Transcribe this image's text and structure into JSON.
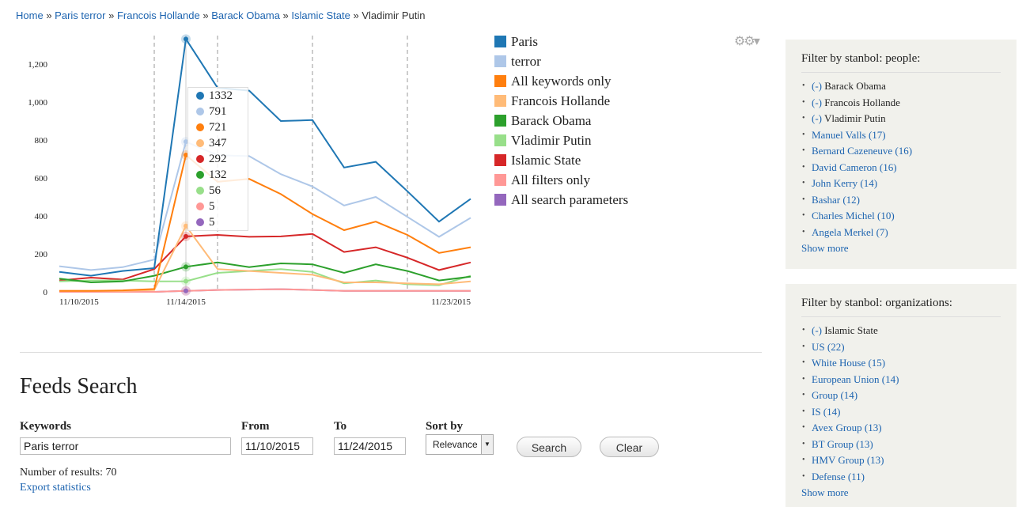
{
  "breadcrumb": {
    "links": [
      "Home",
      "Paris terror",
      "Francois Hollande",
      "Barack Obama",
      "Islamic State"
    ],
    "current": "Vladimir Putin",
    "separator": "»"
  },
  "chart_data": {
    "type": "line",
    "x": [
      "11/10/2015",
      "11/11/2015",
      "11/12/2015",
      "11/13/2015",
      "11/14/2015",
      "11/15/2015",
      "11/16/2015",
      "11/17/2015",
      "11/18/2015",
      "11/19/2015",
      "11/20/2015",
      "11/21/2015",
      "11/22/2015",
      "11/23/2015"
    ],
    "x_tick_labels": [
      "11/10/2015",
      "11/14/2015",
      "11/23/2015"
    ],
    "y_ticks": [
      0,
      200,
      400,
      600,
      800,
      "1,000",
      "1,200"
    ],
    "ylim": [
      0,
      1350
    ],
    "event_markers": [
      "11/13/2015",
      "11/15/2015",
      "11/18/2015",
      "11/21/2015"
    ],
    "series": [
      {
        "name": "Paris",
        "color": "#1f77b4",
        "values": [
          105,
          85,
          110,
          125,
          1332,
          1075,
          1060,
          900,
          905,
          655,
          685,
          530,
          370,
          490
        ]
      },
      {
        "name": "terror",
        "color": "#aec7e8",
        "values": [
          135,
          115,
          130,
          170,
          791,
          720,
          715,
          620,
          555,
          455,
          500,
          395,
          290,
          390
        ]
      },
      {
        "name": "All keywords only",
        "color": "#ff7f0e",
        "values": [
          5,
          5,
          8,
          15,
          721,
          580,
          595,
          515,
          410,
          325,
          370,
          300,
          205,
          235
        ]
      },
      {
        "name": "Francois Hollande",
        "color": "#ffbb78",
        "values": [
          5,
          5,
          5,
          10,
          347,
          120,
          110,
          100,
          90,
          50,
          50,
          45,
          40,
          55
        ]
      },
      {
        "name": "Barack Obama",
        "color": "#2ca02c",
        "values": [
          70,
          50,
          55,
          85,
          132,
          155,
          130,
          150,
          145,
          100,
          145,
          110,
          60,
          80
        ]
      },
      {
        "name": "Vladimir Putin",
        "color": "#98df8a",
        "values": [
          55,
          60,
          60,
          55,
          56,
          100,
          110,
          120,
          105,
          45,
          60,
          40,
          35,
          85
        ]
      },
      {
        "name": "Islamic State",
        "color": "#d62728",
        "values": [
          60,
          75,
          65,
          120,
          292,
          300,
          290,
          292,
          305,
          210,
          235,
          180,
          115,
          155
        ]
      },
      {
        "name": "All filters only",
        "color": "#ff9896",
        "values": [
          0,
          0,
          0,
          0,
          5,
          10,
          12,
          14,
          10,
          5,
          5,
          5,
          5,
          5
        ]
      },
      {
        "name": "All search parameters",
        "color": "#9467bd",
        "values": [
          0,
          0,
          0,
          0,
          5,
          10,
          12,
          14,
          10,
          5,
          5,
          5,
          5,
          5
        ]
      }
    ],
    "tooltip_values": [
      "1332",
      "791",
      "721",
      "347",
      "292",
      "132",
      "56",
      "5",
      "5"
    ],
    "legend_position": "right"
  },
  "icons": {
    "settings": "gear-icon"
  },
  "search": {
    "title": "Feeds Search",
    "keywords_label": "Keywords",
    "keywords_value": "Paris terror",
    "from_label": "From",
    "from_value": "11/10/2015",
    "to_label": "To",
    "to_value": "11/24/2015",
    "sort_label": "Sort by",
    "sort_value": "Relevance",
    "search_button": "Search",
    "clear_button": "Clear",
    "results": "Number of results: 70",
    "export": "Export statistics"
  },
  "people_panel": {
    "title": "Filter by stanbol: people:",
    "active": [
      "(-) Barack Obama",
      "(-) Francois Hollande",
      "(-) Vladimir Putin"
    ],
    "items": [
      "Manuel Valls (17)",
      "Bernard Cazeneuve (16)",
      "David Cameron (16)",
      "John Kerry (14)",
      "Bashar (12)",
      "Charles Michel (10)",
      "Angela Merkel (7)"
    ],
    "more": "Show more"
  },
  "org_panel": {
    "title": "Filter by stanbol: organizations:",
    "active": [
      "(-) Islamic State"
    ],
    "items": [
      "US (22)",
      "White House (15)",
      "European Union (14)",
      "Group (14)",
      "IS (14)",
      "Avex Group (13)",
      "BT Group (13)",
      "HMV Group (13)",
      "Defense (11)"
    ],
    "more": "Show more"
  }
}
